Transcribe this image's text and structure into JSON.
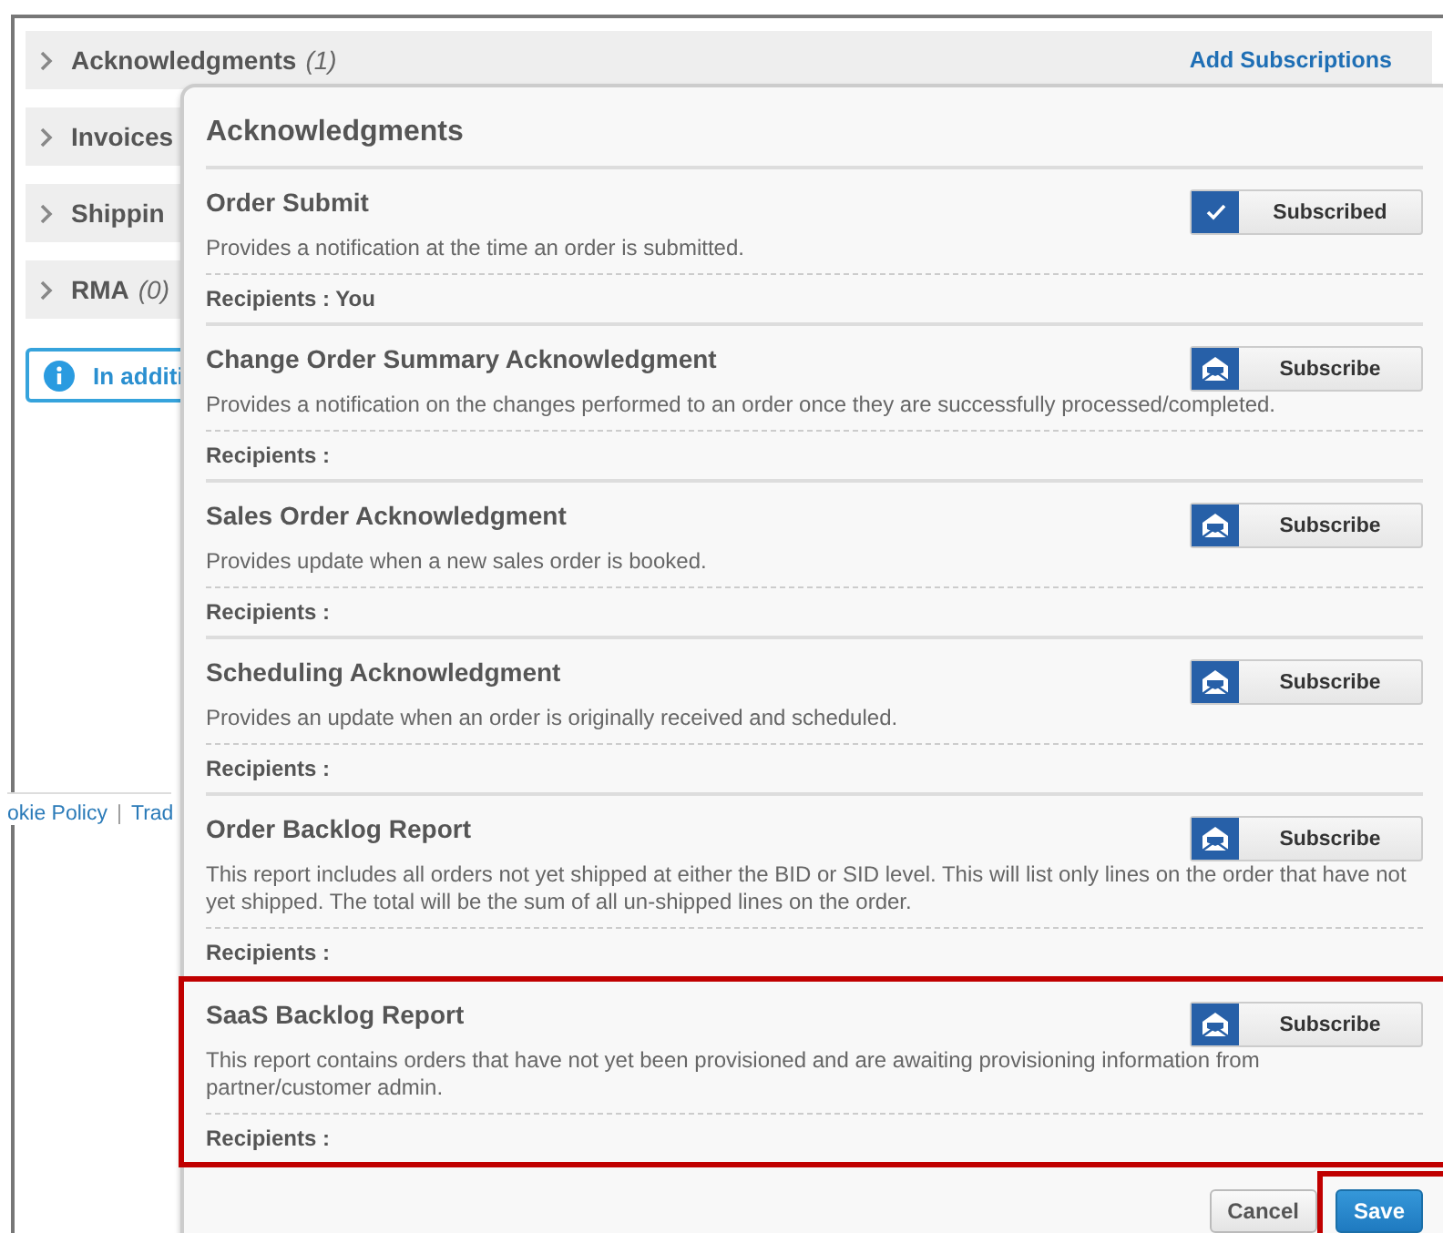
{
  "background": {
    "sections": [
      {
        "label": "Acknowledgments",
        "count": "(1)"
      },
      {
        "label": "Invoices"
      },
      {
        "label": "Shippin"
      },
      {
        "label": "RMA",
        "count": "(0)"
      }
    ],
    "add_link": "Add Subscriptions",
    "info": "In additi",
    "footer_links": [
      "okie Policy",
      "Trad"
    ],
    "footer_separator": "|"
  },
  "dialog": {
    "title": "Acknowledgments",
    "items": [
      {
        "title": "Order Submit",
        "description": "Provides a notification at the time an order is submitted.",
        "recipients": "Recipients : You",
        "subscribed": true,
        "button": "Subscribed",
        "highlighted": false
      },
      {
        "title": "Change Order Summary Acknowledgment",
        "description": "Provides a notification on the changes performed to an order once they are successfully processed/completed.",
        "recipients": "Recipients :",
        "subscribed": false,
        "button": "Subscribe",
        "highlighted": false
      },
      {
        "title": "Sales Order Acknowledgment",
        "description": "Provides update when a new sales order is booked.",
        "recipients": "Recipients :",
        "subscribed": false,
        "button": "Subscribe",
        "highlighted": false
      },
      {
        "title": "Scheduling Acknowledgment",
        "description": "Provides an update when an order is originally received and scheduled.",
        "recipients": "Recipients :",
        "subscribed": false,
        "button": "Subscribe",
        "highlighted": false
      },
      {
        "title": "Order Backlog Report",
        "description": "This report includes all orders not yet shipped at either the BID or SID level. This will list only lines on the order that have not yet shipped. The total will be the sum of all un-shipped lines on the order.",
        "recipients": "Recipients :",
        "subscribed": false,
        "button": "Subscribe",
        "highlighted": false
      },
      {
        "title": "SaaS Backlog Report",
        "description": "This report contains orders that have not yet been provisioned and are awaiting provisioning information from partner/customer admin.",
        "recipients": "Recipients :",
        "subscribed": false,
        "button": "Subscribe",
        "highlighted": true
      }
    ],
    "cancel": "Cancel",
    "save": "Save",
    "save_highlighted": true
  }
}
